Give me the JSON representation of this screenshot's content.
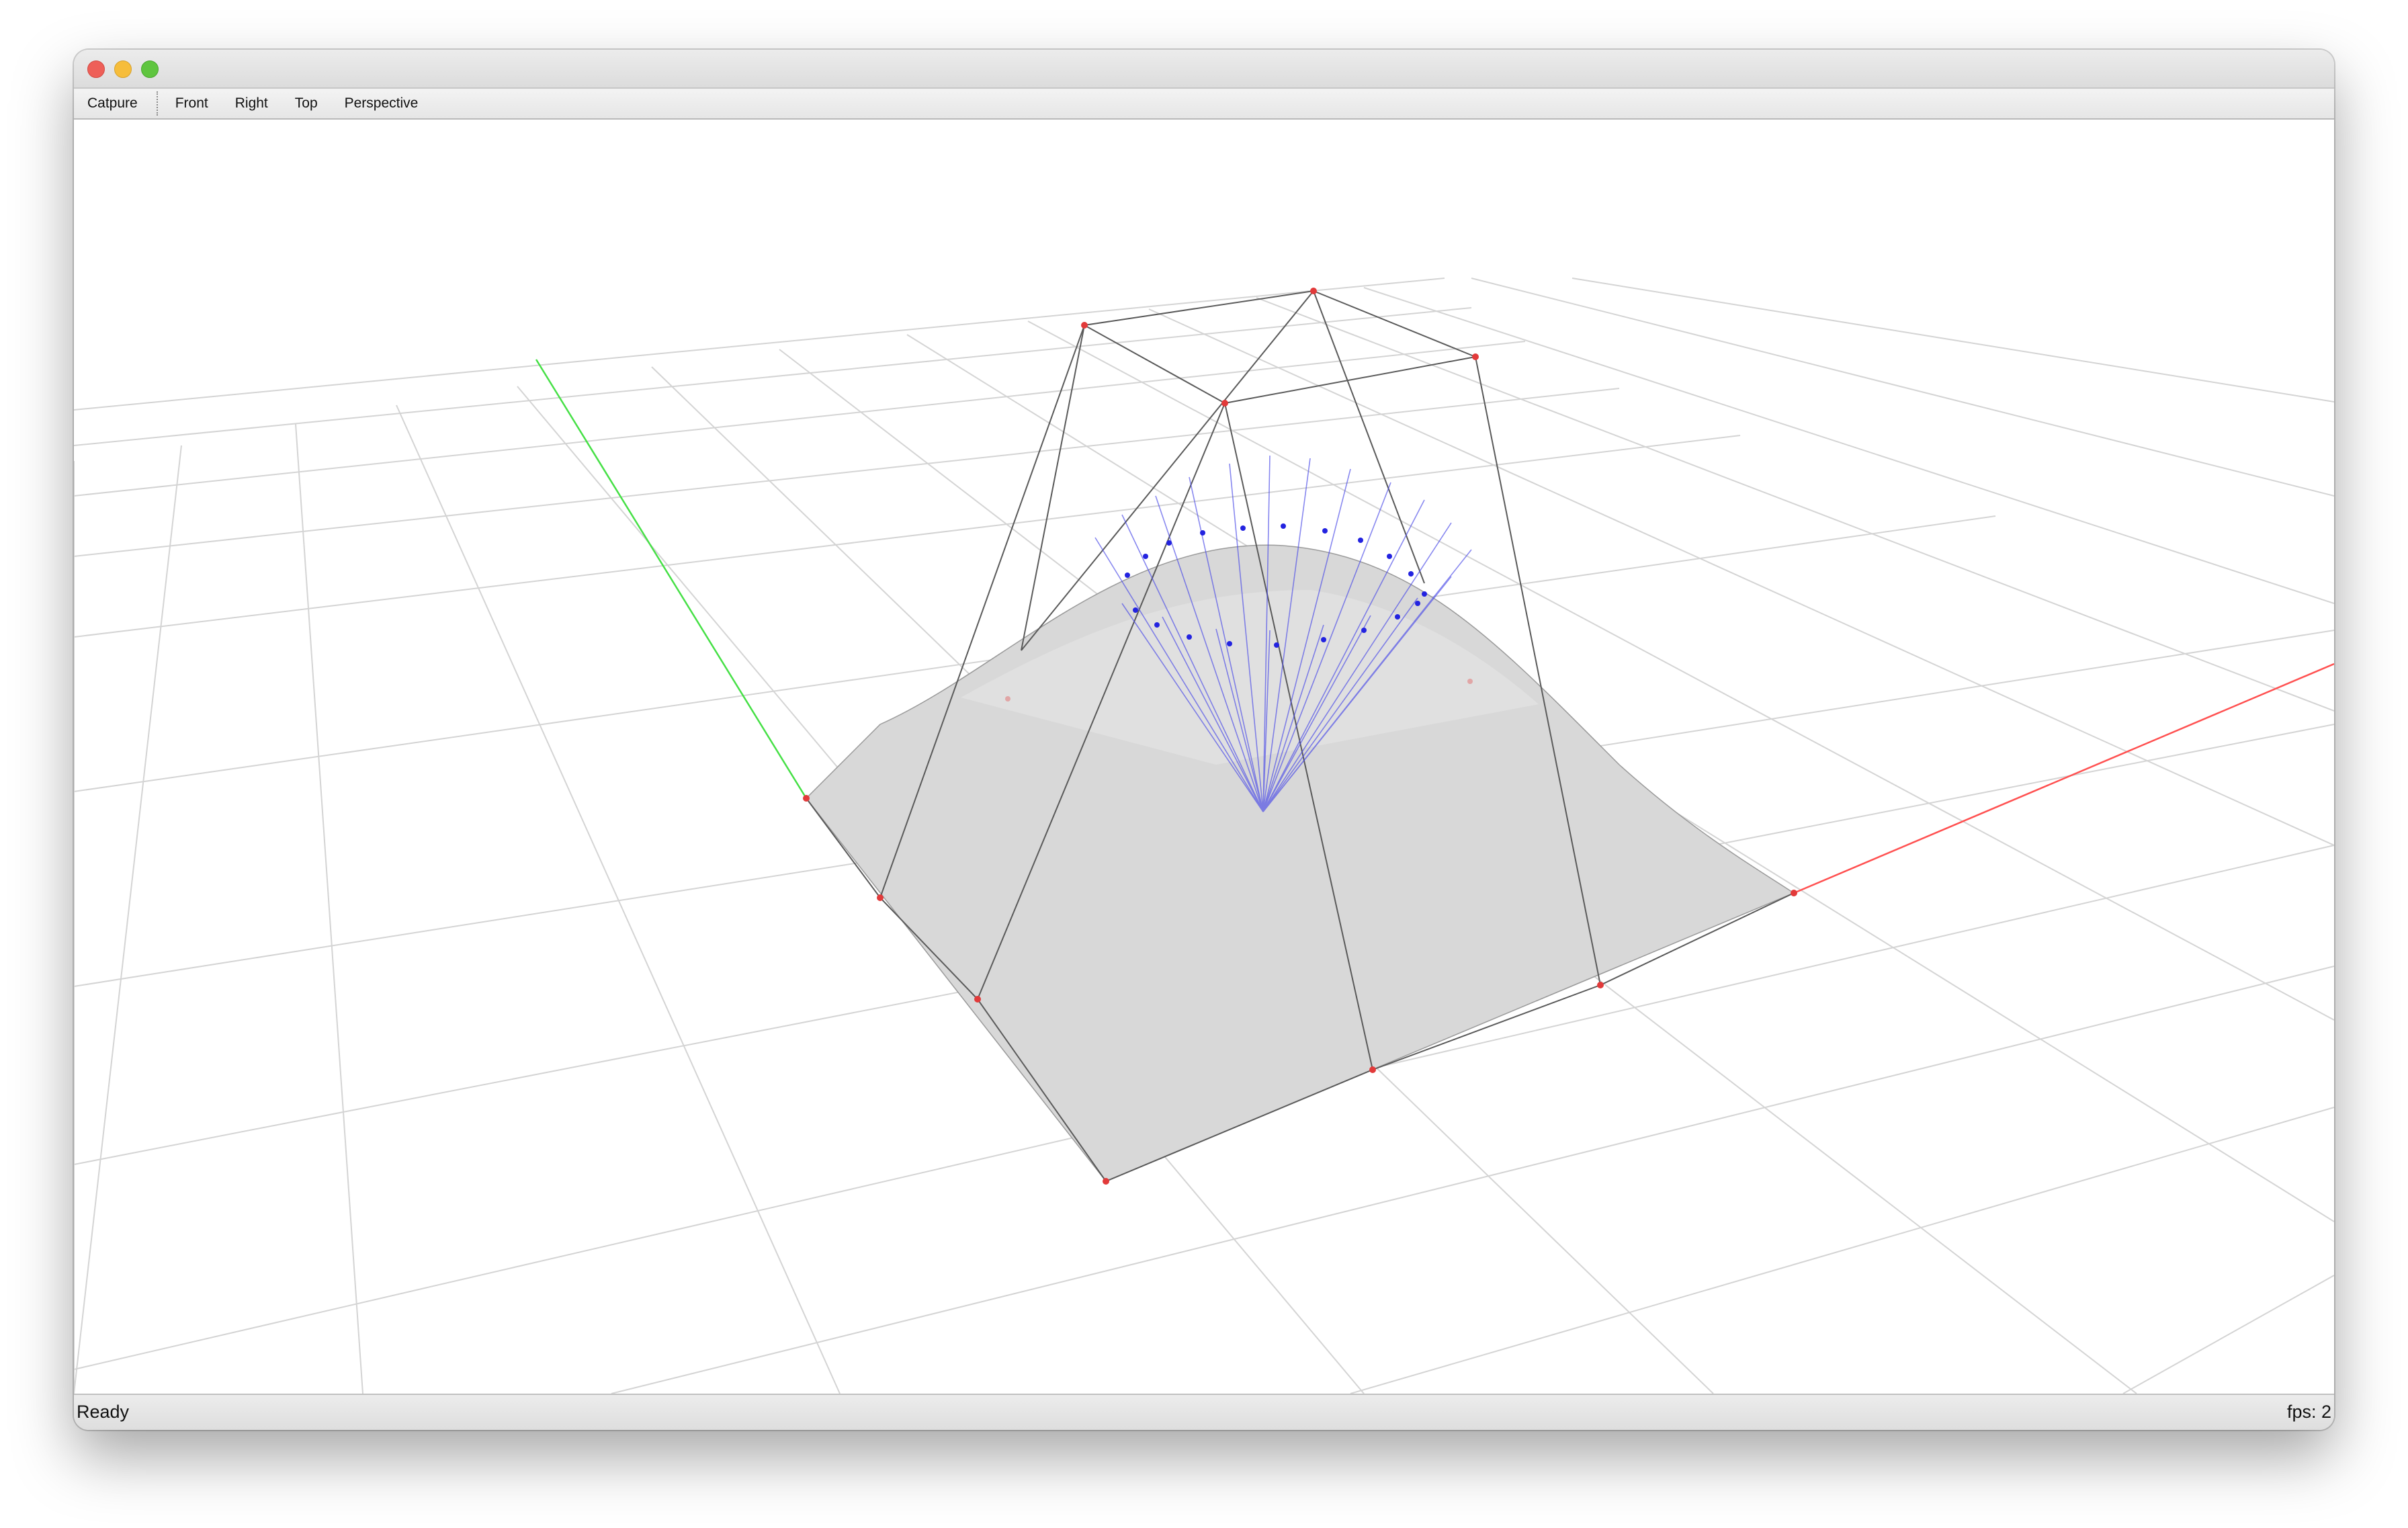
{
  "toolbar": {
    "items": [
      "Catpure",
      "Front",
      "Right",
      "Top",
      "Perspective"
    ]
  },
  "status": {
    "left": "Ready",
    "right": "fps: 2"
  },
  "colors": {
    "x_axis": "#ff5050",
    "y_axis": "#46e046",
    "control_point": "#e23a3a",
    "control_net": "#555555",
    "surface": "#d9d9d9",
    "normals": "#3030e0",
    "grid": "#d2d2d2"
  }
}
